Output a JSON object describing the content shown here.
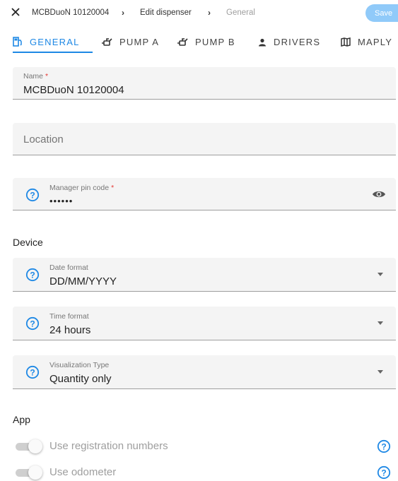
{
  "header": {
    "breadcrumbs": [
      "MCBDuoN 10120004",
      "Edit dispenser",
      "General"
    ],
    "save_label": "Save"
  },
  "tabs": [
    {
      "label": "GENERAL",
      "icon": "gas-station-icon",
      "active": true
    },
    {
      "label": "PUMP A",
      "icon": "pump-icon",
      "active": false
    },
    {
      "label": "PUMP B",
      "icon": "pump-icon",
      "active": false
    },
    {
      "label": "DRIVERS",
      "icon": "person-icon",
      "active": false
    },
    {
      "label": "MAPLY",
      "icon": "map-icon",
      "active": false
    }
  ],
  "form": {
    "name": {
      "label": "Name",
      "required_mark": "*",
      "value": "MCBDuoN 10120004"
    },
    "location": {
      "placeholder": "Location",
      "value": ""
    },
    "manager_pin": {
      "label": "Manager pin code",
      "required_mark": "*",
      "value": "••••••"
    }
  },
  "device": {
    "title": "Device",
    "date_format": {
      "label": "Date format",
      "value": "DD/MM/YYYY"
    },
    "time_format": {
      "label": "Time format",
      "value": "24 hours"
    },
    "visualization_type": {
      "label": "Visualization Type",
      "value": "Quantity only"
    }
  },
  "app": {
    "title": "App",
    "toggles": [
      {
        "label": "Use registration numbers",
        "enabled": false
      },
      {
        "label": "Use odometer",
        "enabled": false
      }
    ]
  },
  "colors": {
    "accent": "#1e88e5",
    "save_button": "#90caf9",
    "help_icon": "#1e88e5",
    "required": "#e53935"
  }
}
